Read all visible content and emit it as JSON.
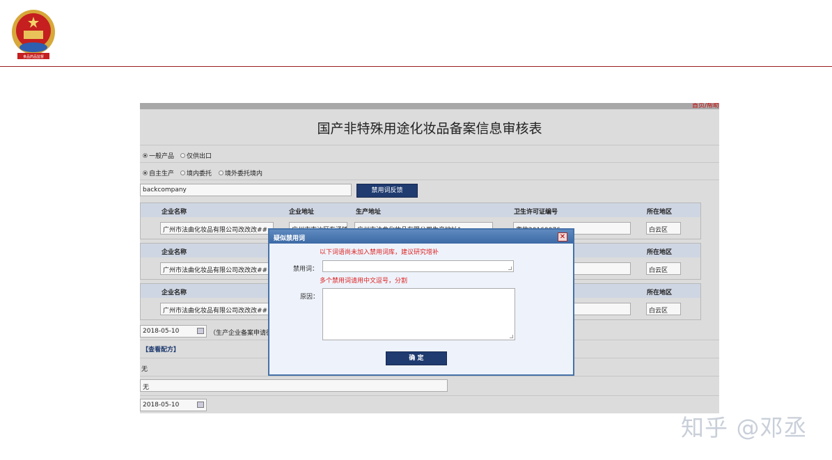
{
  "watermark": "知乎 @邓丞",
  "frame": {
    "corner_link": "首页/帮助",
    "title": "国产非特殊用途化妆品备案信息审核表",
    "product_options": [
      {
        "label": "一般产品",
        "selected": true
      },
      {
        "label": "仅供出口",
        "selected": false
      }
    ],
    "production_options": [
      {
        "label": "自主生产",
        "selected": true
      },
      {
        "label": "境内委托",
        "selected": false
      },
      {
        "label": "境外委托境内",
        "selected": false
      }
    ],
    "company_field": "backcompany",
    "feedback_button": "禁用词反馈",
    "table_headers": {
      "company_name": "企业名称",
      "company_address": "企业地址",
      "production_address": "生产地址",
      "license_no": "卫生许可证编号",
      "region": "所在地区"
    },
    "rows": [
      {
        "company_name": "广州市法曲化妆品有限公司改改改##",
        "company_address": "广州市南沙区东涌镇",
        "production_address": "广州市法曲化妆品有限公司生产地址1",
        "license_no": "粤妆20160076",
        "region": "白云区"
      },
      {
        "company_name": "广州市法曲化妆品有限公司改改改##",
        "region": "白云区"
      },
      {
        "company_name": "广州市法曲化妆品有限公司改改改##",
        "region": "白云区"
      }
    ],
    "date1": "2018-05-10",
    "date1_note": "（生产企业备案申请彼",
    "view_formula": "【查看配方】",
    "none1": "无",
    "none2": "无",
    "date2": "2018-05-10"
  },
  "modal": {
    "title": "疑似禁用词",
    "close": "✕",
    "note_top": "以下词语尚未加入禁用词库，建议研究增补",
    "banned_label": "禁用词：",
    "banned_value": "",
    "note_mid": "多个禁用词请用中文逗号，分割",
    "reason_label": "原因：",
    "reason_value": "",
    "confirm": "确 定"
  }
}
